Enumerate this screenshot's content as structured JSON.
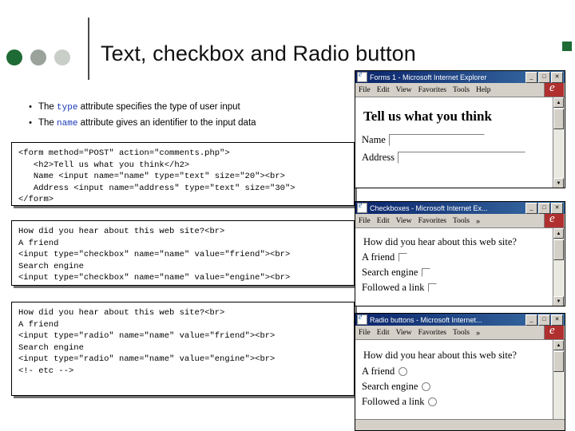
{
  "slide": {
    "title": "Text, checkbox and Radio button",
    "bullets": [
      {
        "marker": "•",
        "pre": "The ",
        "code": "type",
        "post": " attribute specifies the type of user input"
      },
      {
        "marker": "•",
        "pre": "The ",
        "code": "name",
        "post": " attribute gives an identifier to the input data"
      }
    ]
  },
  "code_blocks": {
    "form": "<form method=\"POST\" action=\"comments.php\">\n   <h2>Tell us what you think</h2>\n   Name <input name=\"name\" type=\"text\" size=\"20\"><br>\n   Address <input name=\"address\" type=\"text\" size=\"30\">\n</form>",
    "checkbox": "How did you hear about this web site?<br>\nA friend\n<input type=\"checkbox\" name=\"name\" value=\"friend\"><br>\nSearch engine\n<input type=\"checkbox\" name=\"name\" value=\"engine\"><br>",
    "radio": "How did you hear about this web site?<br>\nA friend\n<input type=\"radio\" name=\"name\" value=\"friend\"><br>\nSearch engine\n<input type=\"radio\" name=\"name\" value=\"engine\"><br>\n<!- etc -->"
  },
  "windows": {
    "forms": {
      "title": "Forms 1 - Microsoft Internet Explorer",
      "menus": [
        "File",
        "Edit",
        "View",
        "Favorites",
        "Tools",
        "Help"
      ],
      "buttons": {
        "minimize": "_",
        "maximize": "□",
        "close": "✕"
      },
      "heading": "Tell us what you think",
      "fields": [
        {
          "label": "Name",
          "value": ""
        },
        {
          "label": "Address",
          "value": ""
        }
      ]
    },
    "checkboxes": {
      "title": "Checkboxes - Microsoft Internet Ex...",
      "menus": [
        "File",
        "Edit",
        "View",
        "Favorites",
        "Tools"
      ],
      "menu_overflow": "»",
      "buttons": {
        "minimize": "_",
        "maximize": "□",
        "close": "✕"
      },
      "question": "How did you hear about this web site?",
      "options": [
        {
          "label": "A friend",
          "type": "checkbox",
          "checked": false
        },
        {
          "label": "Search engine",
          "type": "checkbox",
          "checked": false
        },
        {
          "label": "Followed a link",
          "type": "checkbox",
          "checked": false
        }
      ]
    },
    "radiobuttons": {
      "title": "Radio buttons - Microsoft Internet...",
      "menus": [
        "File",
        "Edit",
        "View",
        "Favorites",
        "Tools"
      ],
      "menu_overflow": "»",
      "buttons": {
        "minimize": "_",
        "maximize": "□",
        "close": "✕"
      },
      "question": "How did you hear about this web site?",
      "options": [
        {
          "label": "A friend",
          "type": "radio",
          "checked": false
        },
        {
          "label": "Search engine",
          "type": "radio",
          "checked": false
        },
        {
          "label": "Followed a link",
          "type": "radio",
          "checked": false
        }
      ]
    }
  },
  "icons": {
    "window_icon": "ie-logo-icon",
    "scroll_up": "▲",
    "scroll_down": "▼"
  }
}
